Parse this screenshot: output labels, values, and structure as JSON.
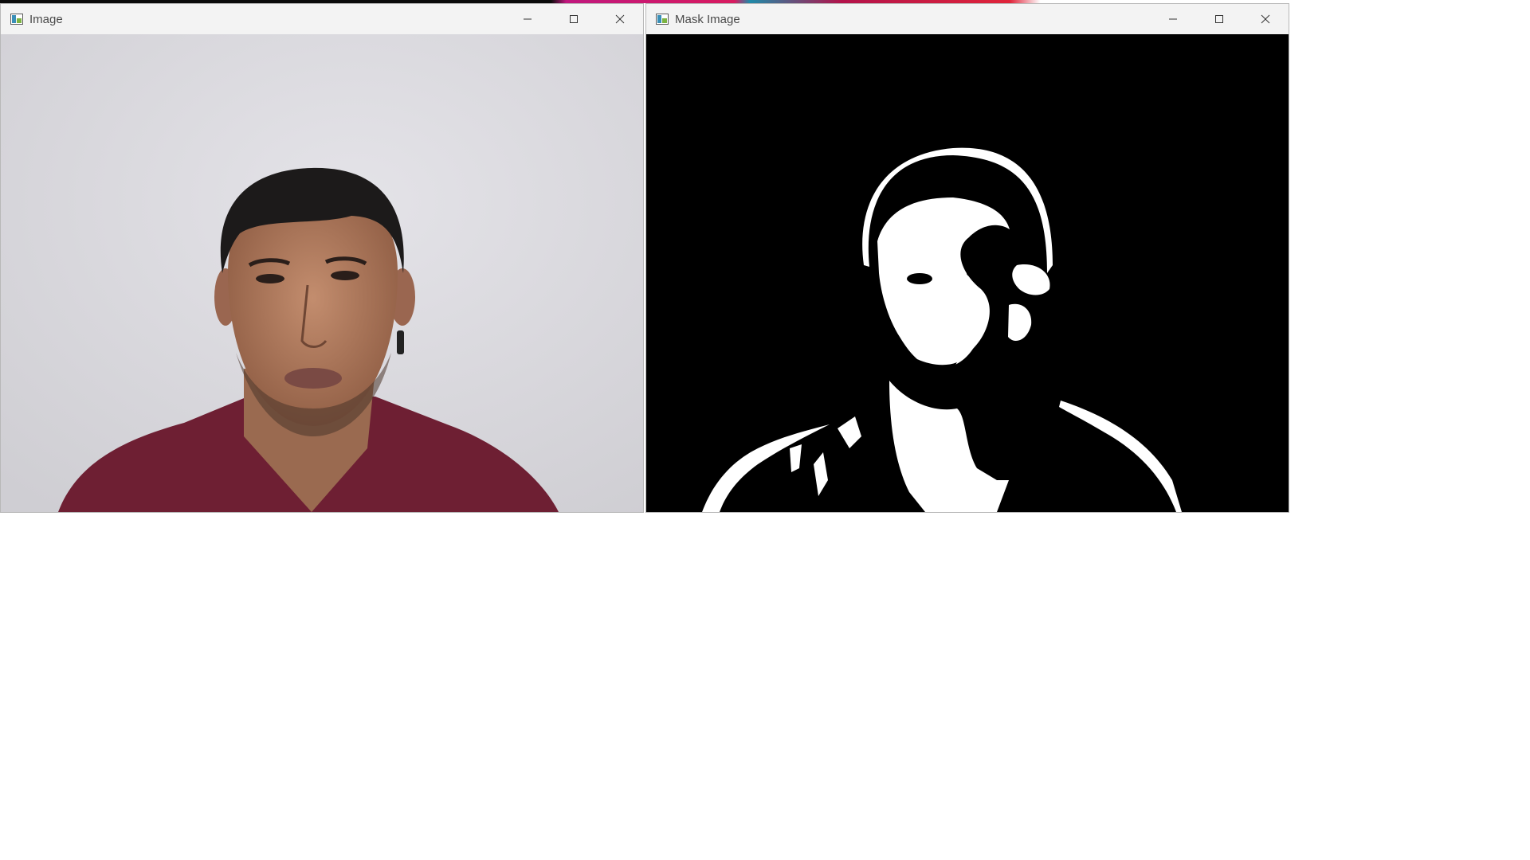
{
  "windows": [
    {
      "title": "Image",
      "content": "webcam frame"
    },
    {
      "title": "Mask Image",
      "content": "binary skin mask"
    }
  ],
  "controls": {
    "minimize": "minimize-icon",
    "maximize": "maximize-icon",
    "close": "close-icon"
  },
  "colors": {
    "titlebar": "#f3f3f3",
    "title_text": "#4a4a4a",
    "mask_background": "#000000",
    "mask_foreground": "#ffffff",
    "wall": "#d9d8dc",
    "shirt": "#6e1f33",
    "skin": "#b07a5c",
    "hair": "#1c1a1a"
  }
}
